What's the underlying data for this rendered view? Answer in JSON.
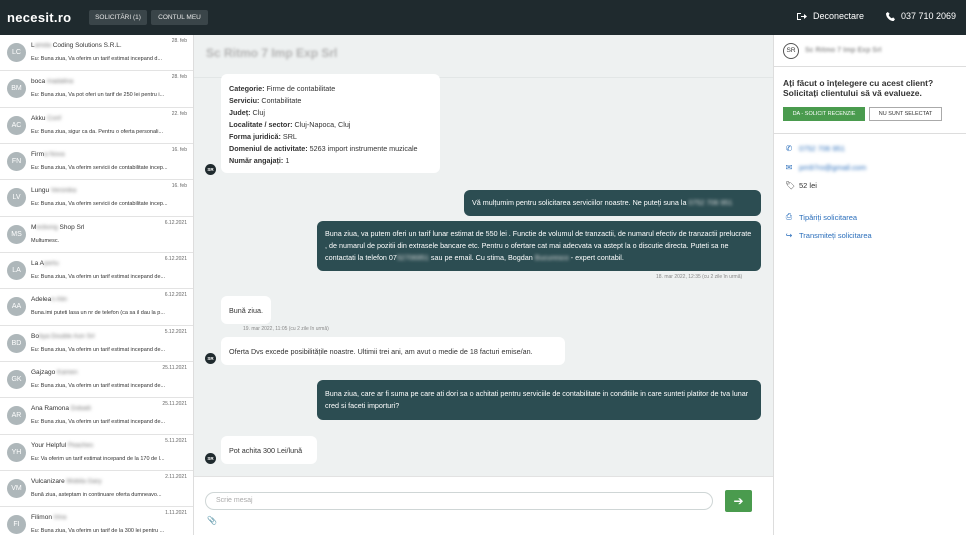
{
  "header": {
    "logo": "necesit.ro",
    "nav": [
      {
        "label": "SOLICITĂRI (1)"
      },
      {
        "label": "CONTUL MEU"
      }
    ],
    "logout_label": "Deconectare",
    "phone": "037 710 2069"
  },
  "conversations": [
    {
      "initials": "LC",
      "name_a": "L",
      "name_blur": "amda",
      "name_b": " Coding Solutions S.R.L.",
      "date": "28. feb",
      "preview": "Eu: Buna ziua, Va oferim un tarif estimat incepand d..."
    },
    {
      "initials": "BM",
      "name_a": "boca ",
      "name_blur": "madalina",
      "name_b": "",
      "date": "28. feb",
      "preview": "Eu: Buna ziua, Va pot oferi un tarif de 250 lei pentru i..."
    },
    {
      "initials": "AC",
      "name_a": "Akku ",
      "name_blur": "Conf",
      "name_b": "",
      "date": "22. feb",
      "preview": "Eu: Buna ziua, sigur ca da. Pentru o oferta personali..."
    },
    {
      "initials": "FN",
      "name_a": "Firm",
      "name_blur": "a Nova",
      "name_b": "",
      "date": "16. feb",
      "preview": "Eu: Buna ziua, Va oferim servicii de contabilitate incep..."
    },
    {
      "initials": "LV",
      "name_a": "Lungu ",
      "name_blur": "Veronika",
      "name_b": "",
      "date": "16. feb",
      "preview": "Eu: Buna ziua, Va oferim servicii de contabilitate incep..."
    },
    {
      "initials": "MS",
      "name_a": "M",
      "name_blur": "ecbong",
      "name_b": " Shop Srl",
      "date": "6.12.2021",
      "preview": "Multumesc."
    },
    {
      "initials": "LA",
      "name_a": "La A",
      "name_blur": "pertu",
      "name_b": "",
      "date": "6.12.2021",
      "preview": "Eu: Buna ziua, Va oferim un tarif estimat incepand de..."
    },
    {
      "initials": "AA",
      "name_a": "Adelea",
      "name_blur": "n Alin",
      "name_b": "",
      "date": "6.12.2021",
      "preview": "Buna.imi puteti lasa un nr de telefon (ca sa il dau la p..."
    },
    {
      "initials": "BD",
      "name_a": "Bo",
      "name_blur": "bya Double Aon Srl",
      "name_b": "",
      "date": "5.12.2021",
      "preview": "Eu: Buna ziua, Va oferim un tarif estimat incepand de..."
    },
    {
      "initials": "GK",
      "name_a": "Gajzago ",
      "name_blur": "Kamen",
      "name_b": "",
      "date": "25.11.2021",
      "preview": "Eu: Buna ziua, Va oferim un tarif estimat incepand de..."
    },
    {
      "initials": "AR",
      "name_a": "Ana Ramona ",
      "name_blur": "Dobaiti",
      "name_b": "",
      "date": "25.11.2021",
      "preview": "Eu: Buna ziua, Va oferim un tarif estimat incepand de..."
    },
    {
      "initials": "YH",
      "name_a": "Your Helpful ",
      "name_blur": "Peaches",
      "name_b": "",
      "date": "5.11.2021",
      "preview": "Eu: Va oferim un tarif estimat incepand de la 170 de l..."
    },
    {
      "initials": "VM",
      "name_a": "Vulcanizare ",
      "name_blur": "Mobila Gary",
      "name_b": "",
      "date": "2.11.2021",
      "preview": "Bună ziua, asteptam in continuare oferta dumneavo..."
    },
    {
      "initials": "FI",
      "name_a": "Filimon ",
      "name_blur": "Irina",
      "name_b": "",
      "date": "1.11.2021",
      "preview": "Eu: Buna ziua, Va oferim un tarif de la 300 lei pentru ..."
    }
  ],
  "chat": {
    "title": "Sc Ritmo 7 Imp Exp Srl",
    "sender_initials": "SR",
    "request": [
      {
        "k": "Categorie:",
        "v": " Firme de contabilitate"
      },
      {
        "k": "Serviciu:",
        "v": " Contabilitate"
      },
      {
        "k": "Județ:",
        "v": " Cluj"
      },
      {
        "k": "Localitate / sector:",
        "v": " Cluj-Napoca, Cluj"
      },
      {
        "k": "Forma juridică:",
        "v": " SRL"
      },
      {
        "k": "Domeniul de activitate:",
        "v": " 5263 import instrumente muzicale"
      },
      {
        "k": "Număr angajați:",
        "v": " 1"
      }
    ],
    "out1_a": "Vă mulțumim pentru solicitarea serviciilor noastre. Ne puteți suna la ",
    "out1_blur": "0752 706 951",
    "out2_a": "Buna ziua, va putem oferi un tarif lunar estimat de 550 lei . Functie de volumul de tranzactii, de numarul efectiv de tranzactii prelucrate , de numarul de pozitii din extrasele bancare etc. Pentru o ofertare cat mai adecvata va astept la o discutie directa. Puteti sa ne contactati la telefon 07",
    "out2_blur": "52706951",
    "out2_b": " sau pe email. Cu stima, Bogdan ",
    "out2_blur2": "Bucuresco",
    "out2_c": " - expert contabil.",
    "ts_out2": "18. mar 2022, 12:35 (cu 2 zile în urmă)",
    "in1": "Bună ziua.",
    "ts_in1": "19. mar 2022, 11:05 (cu 2 zile în urmă)",
    "in2": "Oferta Dvs excede posibilitățile noastre. Ultimii trei ani, am avut o medie de 18 facturi emise/an.",
    "out3": "Buna ziua, care ar fi suma pe care ati dori sa o achitati pentru serviciile de contabilitate in conditiile in care sunteti platitor de tva lunar cred si faceti importuri?",
    "in3": "Pot achita 300 Lei/lună",
    "input_placeholder": "Scrie mesaj"
  },
  "side": {
    "initials": "SR",
    "name": "Sc Ritmo 7 Imp Exp Srl",
    "question": "Ați făcut o înțelegere cu acest client? Solicitați clientului să vă evalueze.",
    "yes_btn": "DA - SOLICIT RECENZIE",
    "no_btn": "NU SUNT SELECTAT",
    "phone": "0752 706 951",
    "email": "pm97ro@gmail.com",
    "price": "52 lei",
    "print": "Tipăriți solicitarea",
    "forward": "Transmiteți solicitarea"
  }
}
